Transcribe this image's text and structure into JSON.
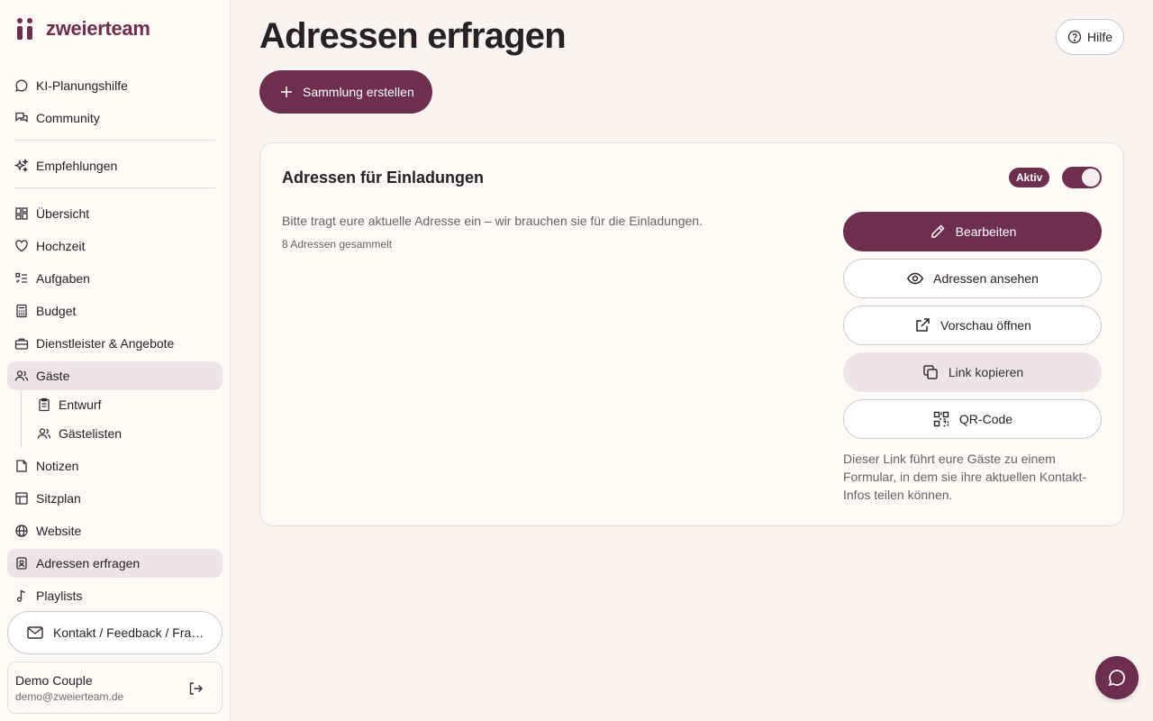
{
  "brand": {
    "name": "zweierteam",
    "accent": "#6e2e4d",
    "icon": "zweierteam-logo"
  },
  "sidebar": {
    "items": [
      {
        "label": "KI-Planungshilfe",
        "icon": "chat-bubble-icon"
      },
      {
        "label": "Community",
        "icon": "chats-icon"
      },
      {
        "label": "Empfehlungen",
        "icon": "sparkles-icon"
      },
      {
        "label": "Übersicht",
        "icon": "dashboard-icon"
      },
      {
        "label": "Hochzeit",
        "icon": "heart-icon"
      },
      {
        "label": "Aufgaben",
        "icon": "checklist-icon"
      },
      {
        "label": "Budget",
        "icon": "calculator-icon"
      },
      {
        "label": "Dienstleister & Angebote",
        "icon": "briefcase-icon"
      },
      {
        "label": "Gäste",
        "icon": "users-icon",
        "active": true
      },
      {
        "label": "Entwurf",
        "icon": "clipboard-icon"
      },
      {
        "label": "Gästelisten",
        "icon": "users-icon"
      },
      {
        "label": "Notizen",
        "icon": "note-icon"
      },
      {
        "label": "Sitzplan",
        "icon": "table-layout-icon"
      },
      {
        "label": "Website",
        "icon": "globe-icon"
      },
      {
        "label": "Adressen erfragen",
        "icon": "contact-card-icon",
        "active": true
      },
      {
        "label": "Playlists",
        "icon": "music-note-icon"
      }
    ],
    "contact_label": "Kontakt / Feedback / Fragen",
    "user": {
      "name": "Demo Couple",
      "email": "demo@zweierteam.de"
    }
  },
  "header": {
    "title": "Adressen erfragen",
    "help_label": "Hilfe",
    "create_label": "Sammlung erstellen"
  },
  "card": {
    "title": "Adressen für Einladungen",
    "status_badge": "Aktiv",
    "toggle_on": true,
    "description": "Bitte tragt eure aktuelle Adresse ein – wir brauchen sie für die Einladungen.",
    "count_text": "8 Adressen gesammelt",
    "actions": {
      "edit": "Bearbeiten",
      "view": "Adressen ansehen",
      "preview": "Vorschau öffnen",
      "copy": "Link kopieren",
      "qr": "QR-Code"
    },
    "note": "Dieser Link führt eure Gäste zu einem Formular, in dem sie ihre aktuellen Kontakt-Infos teilen können."
  }
}
